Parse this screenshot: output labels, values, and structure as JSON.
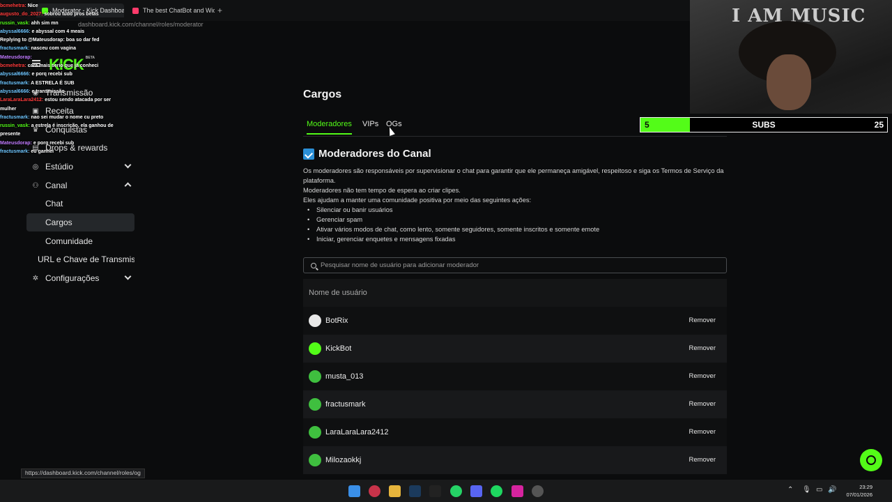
{
  "browser": {
    "tabs": [
      {
        "label": "Moderator - Kick Dashboa",
        "active": true
      },
      {
        "label": "The best ChatBot and Wid",
        "active": false
      }
    ],
    "new_tab": "+",
    "url": "dashboard.kick.com/channel/roles/moderator",
    "status_url": "https://dashboard.kick.com/channel/roles/og"
  },
  "sidebar": {
    "logo": "KICK",
    "logo_badge": "BETA",
    "items": [
      {
        "label": "Transmissão",
        "icon": "broadcast-icon"
      },
      {
        "label": "Receita",
        "icon": "revenue-icon"
      },
      {
        "label": "Conquistas",
        "icon": "trophy-icon"
      },
      {
        "label": "Drops & rewards",
        "icon": "gift-icon"
      },
      {
        "label": "Estúdio",
        "icon": "studio-icon"
      },
      {
        "label": "Canal",
        "icon": "channel-icon"
      },
      {
        "label": "Chat"
      },
      {
        "label": "Cargos"
      },
      {
        "label": "Comunidade"
      },
      {
        "label": "URL e Chave de Transmissã"
      },
      {
        "label": "Configurações",
        "icon": "gear-icon"
      }
    ]
  },
  "chat_overlay": [
    {
      "user": "bcmehetra:",
      "msg": "Nice",
      "color": "#ff3b3b"
    },
    {
      "user": "augusto_do_2027:",
      "msg": "sobrou tudo pros betas",
      "color": "#ff3b3b"
    },
    {
      "user": "russin_vask:",
      "msg": "ahh sim mn",
      "color": "#53fc18"
    },
    {
      "user": "abyssal6666:",
      "msg": "e abyssal com 4 meais",
      "color": "#6ec6ff"
    },
    {
      "user": "",
      "msg": "Replying to @Mateusdorap: boa so dar fed",
      "color": "#cccccc"
    },
    {
      "user": "fractusmark:",
      "msg": "nasceu com vagina",
      "color": "#6ec6ff"
    },
    {
      "user": "Mateusdorap:",
      "msg": "",
      "color": "#c17bff"
    },
    {
      "user": "bcmehetra:",
      "msg": "cara mais serio que já conheci",
      "color": "#ff3b3b"
    },
    {
      "user": "abyssal6666:",
      "msg": "e porq recebi sub",
      "color": "#6ec6ff"
    },
    {
      "user": "fractusmark:",
      "msg": "A ESTRELA É SUB",
      "color": "#6ec6ff"
    },
    {
      "user": "abyssal6666:",
      "msg": "e transmissão",
      "color": "#6ec6ff"
    },
    {
      "user": "LaraLaraLara2412:",
      "msg": "estou sendo atacada por ser mulher",
      "color": "#ff3b3b"
    },
    {
      "user": "fractusmark:",
      "msg": "nao sei mudar o nome cu preto",
      "color": "#6ec6ff"
    },
    {
      "user": "russin_vask:",
      "msg": "a estrela é inscrição, ela ganhou de presente",
      "color": "#53fc18"
    },
    {
      "user": "Mateusdorap:",
      "msg": "e porq recebi sub",
      "color": "#c17bff"
    },
    {
      "user": "fractusmark:",
      "msg": "eu ganhei",
      "color": "#6ec6ff"
    }
  ],
  "main": {
    "title": "Cargos",
    "tabs": [
      "Moderadores",
      "VIPs",
      "OGs"
    ],
    "section_title": "Moderadores do Canal",
    "desc_lines": [
      "Os moderadores são responsáveis por supervisionar o chat para garantir que ele permaneça amigável, respeitoso e siga os Termos de Serviço da plataforma.",
      "Moderadores não tem tempo de espera ao criar clipes.",
      "Eles ajudam a manter uma comunidade positiva por meio das seguintes ações:"
    ],
    "bullets": [
      "Silenciar ou banir usuários",
      "Gerenciar spam",
      "Ativar vários modos de chat, como lento, somente seguidores, somente inscritos e somente emote",
      "Iniciar, gerenciar enquetes e mensagens fixadas"
    ],
    "search_placeholder": "Pesquisar nome de usuário para adicionar moderador",
    "table_header": "Nome de usuário",
    "remove_label": "Remover",
    "moderators": [
      {
        "name": "BotRix",
        "avatar_color": "#e8e8e8"
      },
      {
        "name": "KickBot",
        "avatar_color": "#53fc18"
      },
      {
        "name": "musta_013",
        "avatar_color": "#3fbf3f"
      },
      {
        "name": "fractusmark",
        "avatar_color": "#3fbf3f"
      },
      {
        "name": "LaraLaraLara2412",
        "avatar_color": "#3fbf3f"
      },
      {
        "name": "Milozaokkj",
        "avatar_color": "#3fbf3f"
      }
    ]
  },
  "webcam": {
    "poster_text": "I AM MUSIC"
  },
  "subs_goal": {
    "label": "SUBS",
    "current": "5",
    "goal": "25",
    "progress": 0.2,
    "color": "#53fc18"
  },
  "taskbar": {
    "time": "23:29",
    "date": "07/01/2026"
  },
  "colors": {
    "accent": "#53fc18",
    "background": "#0b0c0d"
  }
}
